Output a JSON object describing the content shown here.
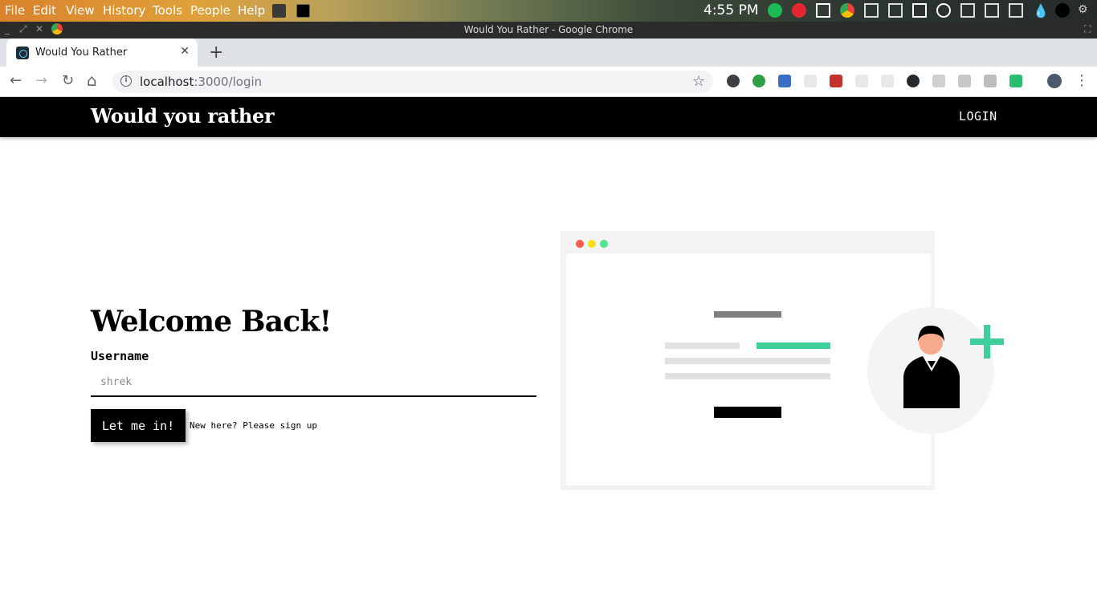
{
  "os": {
    "menu": [
      "File",
      "Edit",
      "View",
      "History",
      "Tools",
      "People",
      "Help"
    ],
    "clock": "4:55 PM"
  },
  "window": {
    "title": "Would You Rather - Google Chrome"
  },
  "tab": {
    "title": "Would You Rather",
    "close": "✕",
    "new_tab": "+"
  },
  "toolbar": {
    "url_host": "localhost",
    "url_rest": ":3000/login",
    "back": "←",
    "forward": "→",
    "reload": "↻",
    "home": "⌂",
    "star": "☆",
    "menu": "⋮"
  },
  "app": {
    "brand": "Would you rather",
    "nav_login": "LOGIN",
    "heading": "Welcome Back!",
    "username_label": "Username",
    "username_placeholder": "shrek",
    "submit_label": "Let me in!",
    "signup_text": "New here? Please sign up"
  },
  "colors": {
    "navbar": "#000000",
    "accent_green": "#3ecf9a",
    "dot_red": "#f25a52",
    "dot_yellow": "#f5e218",
    "dot_green": "#4ee38e"
  }
}
